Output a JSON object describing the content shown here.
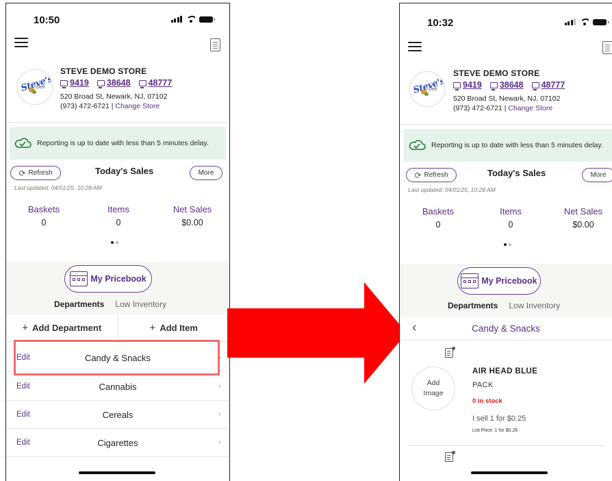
{
  "colors": {
    "accent": "#5b2f86",
    "banner_bg": "#e6f3ea",
    "highlight": "#f06b6b",
    "arrow": "#ff0000",
    "stock_red": "#d42020"
  },
  "left": {
    "status": {
      "time": "10:50"
    },
    "store": {
      "logo_word": "Steve's",
      "logo_deli": "Deli",
      "name": "STEVE DEMO STORE",
      "terminals": [
        "9419",
        "38648",
        "48777"
      ],
      "address": "520 Broad St,  Newark,  NJ, 07102",
      "phone": "(973) 472-6721",
      "change_store": "Change Store"
    },
    "banner": "Reporting is up to date with less than 5 minutes delay.",
    "sales": {
      "refresh": "Refresh",
      "title": "Today's Sales",
      "more": "More",
      "last_updated": "Last updated:  04/01/25, 10:28 AM",
      "stats": [
        {
          "label": "Baskets",
          "value": "0"
        },
        {
          "label": "Items",
          "value": "0"
        },
        {
          "label": "Net Sales",
          "value": "$0.00"
        }
      ]
    },
    "pricebook": {
      "label": "My Pricebook",
      "tab_active": "Departments",
      "tab_inactive": "Low Inventory"
    },
    "actions": {
      "add_department": "Add Department",
      "add_item": "Add Item"
    },
    "departments": [
      {
        "edit": "Edit",
        "name": "Candy & Snacks"
      },
      {
        "edit": "Edit",
        "name": "Cannabis"
      },
      {
        "edit": "Edit",
        "name": "Cereals"
      },
      {
        "edit": "Edit",
        "name": "Cigarettes"
      }
    ]
  },
  "right": {
    "status": {
      "time": "10:32"
    },
    "store": {
      "logo_word": "Steve's",
      "logo_deli": "Deli",
      "name": "STEVE DEMO STORE",
      "terminals": [
        "9419",
        "38648",
        "48777"
      ],
      "address": "520 Broad St,  Newark,  NJ, 07102",
      "phone": "(973) 472-6721",
      "change_store": "Change Store"
    },
    "banner": "Reporting is up to date with less than 5 minutes delay.",
    "sales": {
      "refresh": "Refresh",
      "title": "Today's Sales",
      "more": "More",
      "last_updated": "Last updated:  04/01/25, 10:28 AM",
      "stats": [
        {
          "label": "Baskets",
          "value": "0"
        },
        {
          "label": "Items",
          "value": "0"
        },
        {
          "label": "Net Sales",
          "value": "$0.00"
        }
      ]
    },
    "pricebook": {
      "label": "My Pricebook",
      "tab_active": "Departments",
      "tab_inactive": "Low Inventory"
    },
    "category_title": "Candy & Snacks",
    "product": {
      "add_image": "Add Image",
      "name": "AIR HEAD BLUE",
      "sub": "PACK",
      "stock": "0 in stock",
      "sell": "I sell 1 for $0.25",
      "list_price": "List Price: 1 for $0.26"
    }
  }
}
